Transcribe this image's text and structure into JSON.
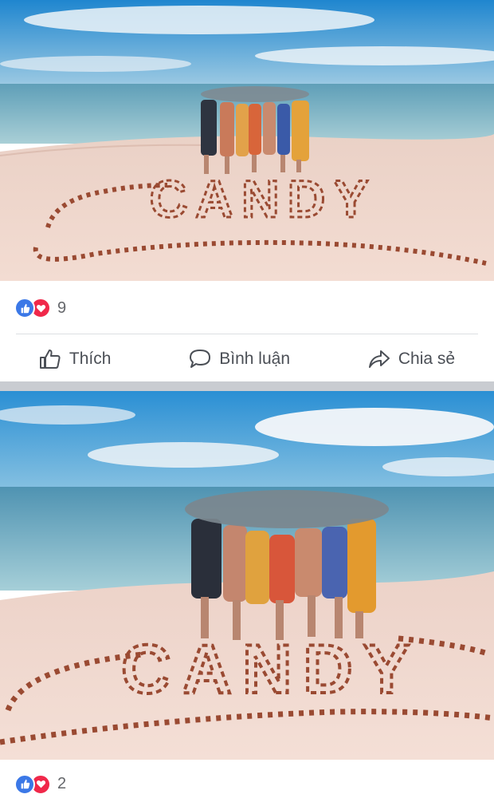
{
  "post1": {
    "sand_text": "CANDY",
    "reaction_count": "9",
    "reaction_icons": [
      "like-icon",
      "love-icon"
    ]
  },
  "actions": {
    "like_label": "Thích",
    "comment_label": "Bình luận",
    "share_label": "Chia sẻ"
  },
  "post2": {
    "sand_text": "CANDY",
    "reaction_count": "2",
    "reaction_icons": [
      "like-icon",
      "love-icon"
    ]
  },
  "colors": {
    "sky": "#3f9bd6",
    "sea": "#7fb8c9",
    "sand": "#f1d3c8",
    "starfish": "#9a4a32",
    "like_blue": "#3b78e7",
    "love_red": "#f0284a",
    "separator": "#c9ccd1"
  }
}
